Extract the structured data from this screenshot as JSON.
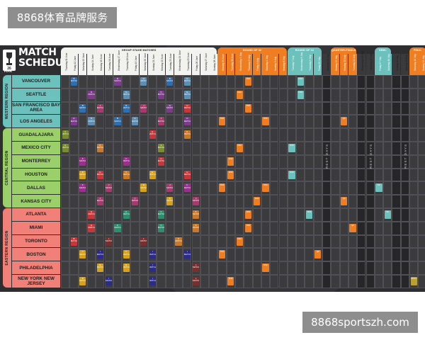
{
  "watermark": {
    "top_text": "8868体育品牌服务",
    "bottom_text": "8868sportszh.com"
  },
  "poster": {
    "title_line1": "MATCH",
    "title_line2": "SCHEDULE",
    "logo_label": "FIFA",
    "stage_bands": [
      {
        "id": "group",
        "label": "GROUP STAGE MATCHES",
        "color": "#f2f2ee",
        "text_color": "#1d1d1d",
        "col_start": 0,
        "col_end": 17
      },
      {
        "id": "r32",
        "label": "ROUND OF 32",
        "color": "#ef7e22",
        "text_color": "#ffffff",
        "col_start": 18,
        "col_end": 25
      },
      {
        "id": "r16",
        "label": "ROUND OF 16",
        "color": "#6cc1bd",
        "text_color": "#ffffff",
        "col_start": 26,
        "col_end": 29
      },
      {
        "id": "qf",
        "label": "QUARTER-FINALS",
        "color": "#ef7e22",
        "text_color": "#ffffff",
        "col_start": 31,
        "col_end": 33
      },
      {
        "id": "sf",
        "label": "SEMI-FINALS",
        "color": "#6cc1bd",
        "text_color": "#ffffff",
        "col_start": 36,
        "col_end": 37
      },
      {
        "id": "final",
        "label": "FINAL",
        "color": "#ef7e22",
        "text_color": "#ffffff",
        "col_start": 40,
        "col_end": 41
      }
    ],
    "dates": [
      "Thursday 11 June",
      "Friday 12 June",
      "Saturday 13 June",
      "Sunday 14 June",
      "Monday 15 June",
      "Tuesday 16 June",
      "Wednesday 17 June",
      "Thursday 18 June",
      "Friday 19 June",
      "Saturday 20 June",
      "Sunday 21 June",
      "Monday 22 June",
      "Tuesday 23 June",
      "Wednesday 24 June",
      "Thursday 25 June",
      "Friday 26 June",
      "Saturday 27 June",
      "Sunday 28 June",
      "Monday 29 June",
      "Tuesday 30 June",
      "Wednesday 1 July",
      "Thursday 2 July",
      "Friday 3 July",
      "Saturday 4 July",
      "Sunday 5 July",
      "Monday 6 July",
      "Tuesday 7 July",
      "Wednesday 8 July",
      "Thursday 9 July",
      "Friday 10 July",
      "Saturday 11 July",
      "Sunday 12 July",
      "Monday 13 July",
      "Tuesday 14 July",
      "Wednesday 15 July",
      "Thursday 16 July",
      "Friday 17 July",
      "Saturday 18 July",
      "Sunday 19 July",
      "Monday 20 July",
      "Saturday 18 July",
      "Sunday 19 July"
    ],
    "regions": [
      {
        "label": "WESTERN REGION",
        "color": "#6cc1bd",
        "row_start": 0,
        "row_end": 3
      },
      {
        "label": "CENTRAL REGION",
        "color": "#9bcf6a",
        "row_start": 4,
        "row_end": 9
      },
      {
        "label": "EASTERN REGION",
        "color": "#f08078",
        "row_start": 10,
        "row_end": 15
      }
    ],
    "cities": [
      {
        "label": "VANCOUVER",
        "color": "#6cc1bd"
      },
      {
        "label": "SEATTLE",
        "color": "#6cc1bd"
      },
      {
        "label": "SAN FRANCISCO BAY AREA",
        "color": "#6cc1bd"
      },
      {
        "label": "LOS ANGELES",
        "color": "#6cc1bd"
      },
      {
        "label": "GUADALAJARA",
        "color": "#9bcf6a"
      },
      {
        "label": "MEXICO CITY",
        "color": "#9bcf6a"
      },
      {
        "label": "MONTERREY",
        "color": "#9bcf6a"
      },
      {
        "label": "HOUSTON",
        "color": "#9bcf6a"
      },
      {
        "label": "DALLAS",
        "color": "#9bcf6a"
      },
      {
        "label": "KANSAS CITY",
        "color": "#9bcf6a"
      },
      {
        "label": "ATLANTA",
        "color": "#f08078"
      },
      {
        "label": "MIAMI",
        "color": "#f08078"
      },
      {
        "label": "TORONTO",
        "color": "#f08078"
      },
      {
        "label": "BOSTON",
        "color": "#f08078"
      },
      {
        "label": "PHILADELPHIA",
        "color": "#f08078"
      },
      {
        "label": "NEW YORK NEW JERSEY",
        "color": "#f08078"
      }
    ],
    "rest_days_label": "REST DAYS",
    "rest_day_cols": [
      30,
      34,
      35,
      38,
      39
    ],
    "palette": {
      "A": "#7a8c2e",
      "B": "#2f6fb0",
      "C": "#2d8e6e",
      "D": "#7d3b8c",
      "E": "#d6a21c",
      "F": "#9b2f8e",
      "G": "#5e8fb2",
      "H": "#c8363a",
      "I": "#2b2b8c",
      "J": "#a53b6c",
      "K": "#c87a2a",
      "L": "#7a2f2f",
      "r32": "#ef7e22",
      "r16": "#6cc1bd",
      "qf": "#ef7e22",
      "sf": "#6cc1bd",
      "final": "#b9a036"
    },
    "matches": [
      {
        "row": 0,
        "col": 1,
        "label": "B MATCH",
        "code": "B"
      },
      {
        "row": 0,
        "col": 6,
        "label": "D MATCH",
        "code": "D"
      },
      {
        "row": 0,
        "col": 9,
        "label": "G MATCH",
        "code": "G"
      },
      {
        "row": 0,
        "col": 12,
        "label": "B MATCH",
        "code": "B"
      },
      {
        "row": 0,
        "col": 14,
        "label": "G MATCH",
        "code": "G"
      },
      {
        "row": 0,
        "col": 21,
        "label": "R32",
        "code": "r32"
      },
      {
        "row": 0,
        "col": 27,
        "label": "R16",
        "code": "r16"
      },
      {
        "row": 1,
        "col": 3,
        "label": "D MATCH",
        "code": "D"
      },
      {
        "row": 1,
        "col": 7,
        "label": "G MATCH",
        "code": "G"
      },
      {
        "row": 1,
        "col": 11,
        "label": "D MATCH",
        "code": "D"
      },
      {
        "row": 1,
        "col": 14,
        "label": "G MATCH",
        "code": "G"
      },
      {
        "row": 1,
        "col": 20,
        "label": "R32",
        "code": "r32"
      },
      {
        "row": 1,
        "col": 27,
        "label": "R16",
        "code": "r16"
      },
      {
        "row": 2,
        "col": 2,
        "label": "B MATCH",
        "code": "B"
      },
      {
        "row": 2,
        "col": 4,
        "label": "J MATCH",
        "code": "J"
      },
      {
        "row": 2,
        "col": 7,
        "label": "B MATCH",
        "code": "B"
      },
      {
        "row": 2,
        "col": 9,
        "label": "J MATCH",
        "code": "J"
      },
      {
        "row": 2,
        "col": 12,
        "label": "D MATCH",
        "code": "D"
      },
      {
        "row": 2,
        "col": 14,
        "label": "H MATCH",
        "code": "H"
      },
      {
        "row": 2,
        "col": 21,
        "label": "R32",
        "code": "r32"
      },
      {
        "row": 3,
        "col": 1,
        "label": "D MATCH",
        "code": "D"
      },
      {
        "row": 3,
        "col": 3,
        "label": "G MATCH",
        "code": "G"
      },
      {
        "row": 3,
        "col": 6,
        "label": "B MATCH",
        "code": "B"
      },
      {
        "row": 3,
        "col": 8,
        "label": "G MATCH",
        "code": "G"
      },
      {
        "row": 3,
        "col": 11,
        "label": "J MATCH",
        "code": "J"
      },
      {
        "row": 3,
        "col": 14,
        "label": "D MATCH",
        "code": "D"
      },
      {
        "row": 3,
        "col": 18,
        "label": "R32",
        "code": "r32"
      },
      {
        "row": 3,
        "col": 23,
        "label": "R32",
        "code": "r32"
      },
      {
        "row": 3,
        "col": 32,
        "label": "QF",
        "code": "qf"
      },
      {
        "row": 4,
        "col": 0,
        "label": "A MATCH",
        "code": "A"
      },
      {
        "row": 4,
        "col": 10,
        "label": "H MATCH",
        "code": "H"
      },
      {
        "row": 4,
        "col": 14,
        "label": "K MATCH",
        "code": "K"
      },
      {
        "row": 5,
        "col": 0,
        "label": "A MATCH",
        "code": "A"
      },
      {
        "row": 5,
        "col": 4,
        "label": "K MATCH",
        "code": "K"
      },
      {
        "row": 5,
        "col": 11,
        "label": "A MATCH",
        "code": "A"
      },
      {
        "row": 5,
        "col": 20,
        "label": "R32",
        "code": "r32"
      },
      {
        "row": 5,
        "col": 26,
        "label": "R16",
        "code": "r16"
      },
      {
        "row": 6,
        "col": 2,
        "label": "F MATCH",
        "code": "F"
      },
      {
        "row": 6,
        "col": 7,
        "label": "F MATCH",
        "code": "F"
      },
      {
        "row": 6,
        "col": 11,
        "label": "H MATCH",
        "code": "H"
      },
      {
        "row": 6,
        "col": 19,
        "label": "R32",
        "code": "r32"
      },
      {
        "row": 7,
        "col": 2,
        "label": "E MATCH",
        "code": "E"
      },
      {
        "row": 7,
        "col": 4,
        "label": "H MATCH",
        "code": "H"
      },
      {
        "row": 7,
        "col": 7,
        "label": "K MATCH",
        "code": "K"
      },
      {
        "row": 7,
        "col": 10,
        "label": "E MATCH",
        "code": "E"
      },
      {
        "row": 7,
        "col": 14,
        "label": "H MATCH",
        "code": "H"
      },
      {
        "row": 7,
        "col": 19,
        "label": "R32",
        "code": "r32"
      },
      {
        "row": 7,
        "col": 26,
        "label": "R16",
        "code": "r16"
      },
      {
        "row": 8,
        "col": 2,
        "label": "F MATCH",
        "code": "F"
      },
      {
        "row": 8,
        "col": 5,
        "label": "J MATCH",
        "code": "J"
      },
      {
        "row": 8,
        "col": 9,
        "label": "E MATCH",
        "code": "E"
      },
      {
        "row": 8,
        "col": 12,
        "label": "J MATCH",
        "code": "J"
      },
      {
        "row": 8,
        "col": 14,
        "label": "F MATCH",
        "code": "F"
      },
      {
        "row": 8,
        "col": 18,
        "label": "R32",
        "code": "r32"
      },
      {
        "row": 8,
        "col": 23,
        "label": "R32",
        "code": "r32"
      },
      {
        "row": 8,
        "col": 36,
        "label": "SF",
        "code": "sf"
      },
      {
        "row": 9,
        "col": 4,
        "label": "J MATCH",
        "code": "J"
      },
      {
        "row": 9,
        "col": 8,
        "label": "J MATCH",
        "code": "J"
      },
      {
        "row": 9,
        "col": 12,
        "label": "E MATCH",
        "code": "E"
      },
      {
        "row": 9,
        "col": 15,
        "label": "J MATCH",
        "code": "J"
      },
      {
        "row": 9,
        "col": 22,
        "label": "R32",
        "code": "r32"
      },
      {
        "row": 9,
        "col": 32,
        "label": "QF",
        "code": "qf"
      },
      {
        "row": 10,
        "col": 3,
        "label": "H MATCH",
        "code": "H"
      },
      {
        "row": 10,
        "col": 7,
        "label": "C MATCH",
        "code": "C"
      },
      {
        "row": 10,
        "col": 11,
        "label": "C MATCH",
        "code": "C"
      },
      {
        "row": 10,
        "col": 15,
        "label": "K MATCH",
        "code": "K"
      },
      {
        "row": 10,
        "col": 21,
        "label": "R32",
        "code": "r32"
      },
      {
        "row": 10,
        "col": 28,
        "label": "R16",
        "code": "r16"
      },
      {
        "row": 10,
        "col": 37,
        "label": "SF",
        "code": "sf"
      },
      {
        "row": 11,
        "col": 3,
        "label": "H MATCH",
        "code": "H"
      },
      {
        "row": 11,
        "col": 6,
        "label": "C MATCH",
        "code": "C"
      },
      {
        "row": 11,
        "col": 11,
        "label": "C MATCH",
        "code": "C"
      },
      {
        "row": 11,
        "col": 15,
        "label": "K MATCH",
        "code": "K"
      },
      {
        "row": 11,
        "col": 21,
        "label": "R32",
        "code": "r32"
      },
      {
        "row": 11,
        "col": 33,
        "label": "QF",
        "code": "qf"
      },
      {
        "row": 12,
        "col": 1,
        "label": "B MATCH",
        "code": "H"
      },
      {
        "row": 12,
        "col": 5,
        "label": "L MATCH",
        "code": "L"
      },
      {
        "row": 12,
        "col": 9,
        "label": "L MATCH",
        "code": "L"
      },
      {
        "row": 12,
        "col": 13,
        "label": "K MATCH",
        "code": "K"
      },
      {
        "row": 12,
        "col": 20,
        "label": "R32",
        "code": "r32"
      },
      {
        "row": 13,
        "col": 2,
        "label": "C MATCH",
        "code": "E"
      },
      {
        "row": 13,
        "col": 4,
        "label": "I MATCH",
        "code": "I"
      },
      {
        "row": 13,
        "col": 7,
        "label": "C MATCH",
        "code": "E"
      },
      {
        "row": 13,
        "col": 10,
        "label": "I MATCH",
        "code": "I"
      },
      {
        "row": 13,
        "col": 14,
        "label": "I MATCH",
        "code": "I"
      },
      {
        "row": 13,
        "col": 18,
        "label": "R32",
        "code": "r32"
      },
      {
        "row": 13,
        "col": 29,
        "label": "QF",
        "code": "qf"
      },
      {
        "row": 14,
        "col": 4,
        "label": "E MATCH",
        "code": "E"
      },
      {
        "row": 14,
        "col": 7,
        "label": "E MATCH",
        "code": "E"
      },
      {
        "row": 14,
        "col": 10,
        "label": "I MATCH",
        "code": "I"
      },
      {
        "row": 14,
        "col": 15,
        "label": "L MATCH",
        "code": "L"
      },
      {
        "row": 14,
        "col": 23,
        "label": "R32",
        "code": "r32"
      },
      {
        "row": 15,
        "col": 2,
        "label": "E MATCH",
        "code": "E"
      },
      {
        "row": 15,
        "col": 5,
        "label": "I MATCH",
        "code": "I"
      },
      {
        "row": 15,
        "col": 10,
        "label": "I MATCH",
        "code": "I"
      },
      {
        "row": 15,
        "col": 15,
        "label": "L MATCH",
        "code": "L"
      },
      {
        "row": 15,
        "col": 19,
        "label": "R32",
        "code": "r32"
      },
      {
        "row": 15,
        "col": 40,
        "label": "FINAL",
        "code": "final"
      }
    ]
  }
}
